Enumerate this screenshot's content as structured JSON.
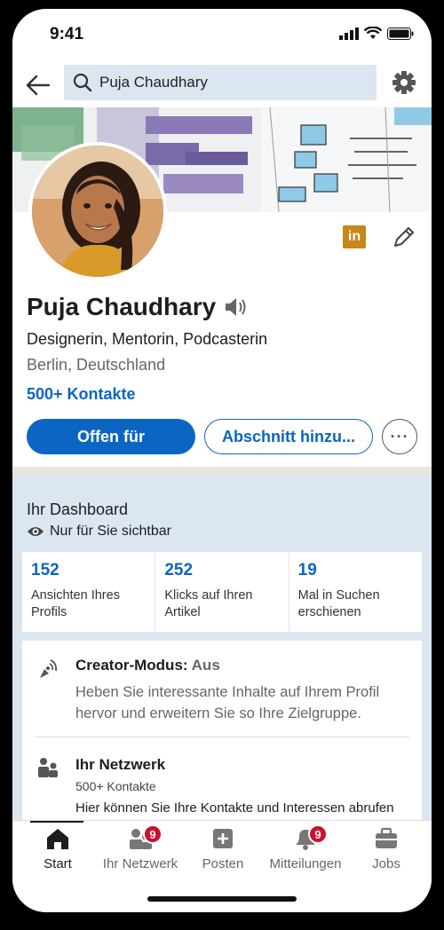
{
  "status_bar": {
    "time": "9:41"
  },
  "search": {
    "query": "Puja Chaudhary"
  },
  "profile": {
    "name": "Puja Chaudhary",
    "headline": "Designerin, Mentorin, Podcasterin",
    "location": "Berlin, Deutschland",
    "contacts": "500+ Kontakte",
    "open_for_label": "Offen für",
    "add_section_label": "Abschnitt hinzu...",
    "more_label": "···"
  },
  "dashboard": {
    "title": "Ihr Dashboard",
    "visibility": "Nur für Sie sichtbar",
    "stats": [
      {
        "value": "152",
        "label": "Ansichten Ihres Profils"
      },
      {
        "value": "252",
        "label": "Klicks auf Ihren Artikel"
      },
      {
        "value": "19",
        "label": "Mal in Suchen erschienen"
      }
    ],
    "creator": {
      "title": "Creator-Modus:",
      "status": "Aus",
      "description": "Heben Sie interessante Inhalte auf Ihrem Profil hervor und erweitern Sie so Ihre Zielgruppe."
    },
    "network": {
      "title": "Ihr Netzwerk",
      "count": "500+ Kontakte",
      "description": "Hier können Sie Ihre Kontakte und Interessen abrufen und verwalten."
    }
  },
  "bottom_nav": {
    "items": [
      {
        "label": "Start",
        "icon": "home-icon"
      },
      {
        "label": "Ihr Netzwerk",
        "icon": "network-icon",
        "badge": "9"
      },
      {
        "label": "Posten",
        "icon": "post-icon"
      },
      {
        "label": "Mitteilungen",
        "icon": "bell-icon",
        "badge": "9"
      },
      {
        "label": "Jobs",
        "icon": "briefcase-icon"
      }
    ]
  },
  "colors": {
    "accent": "#0a66c2",
    "dashboard_bg": "#dce6f1",
    "badge": "#cb112d",
    "linkedin_badge": "#c9851a"
  }
}
